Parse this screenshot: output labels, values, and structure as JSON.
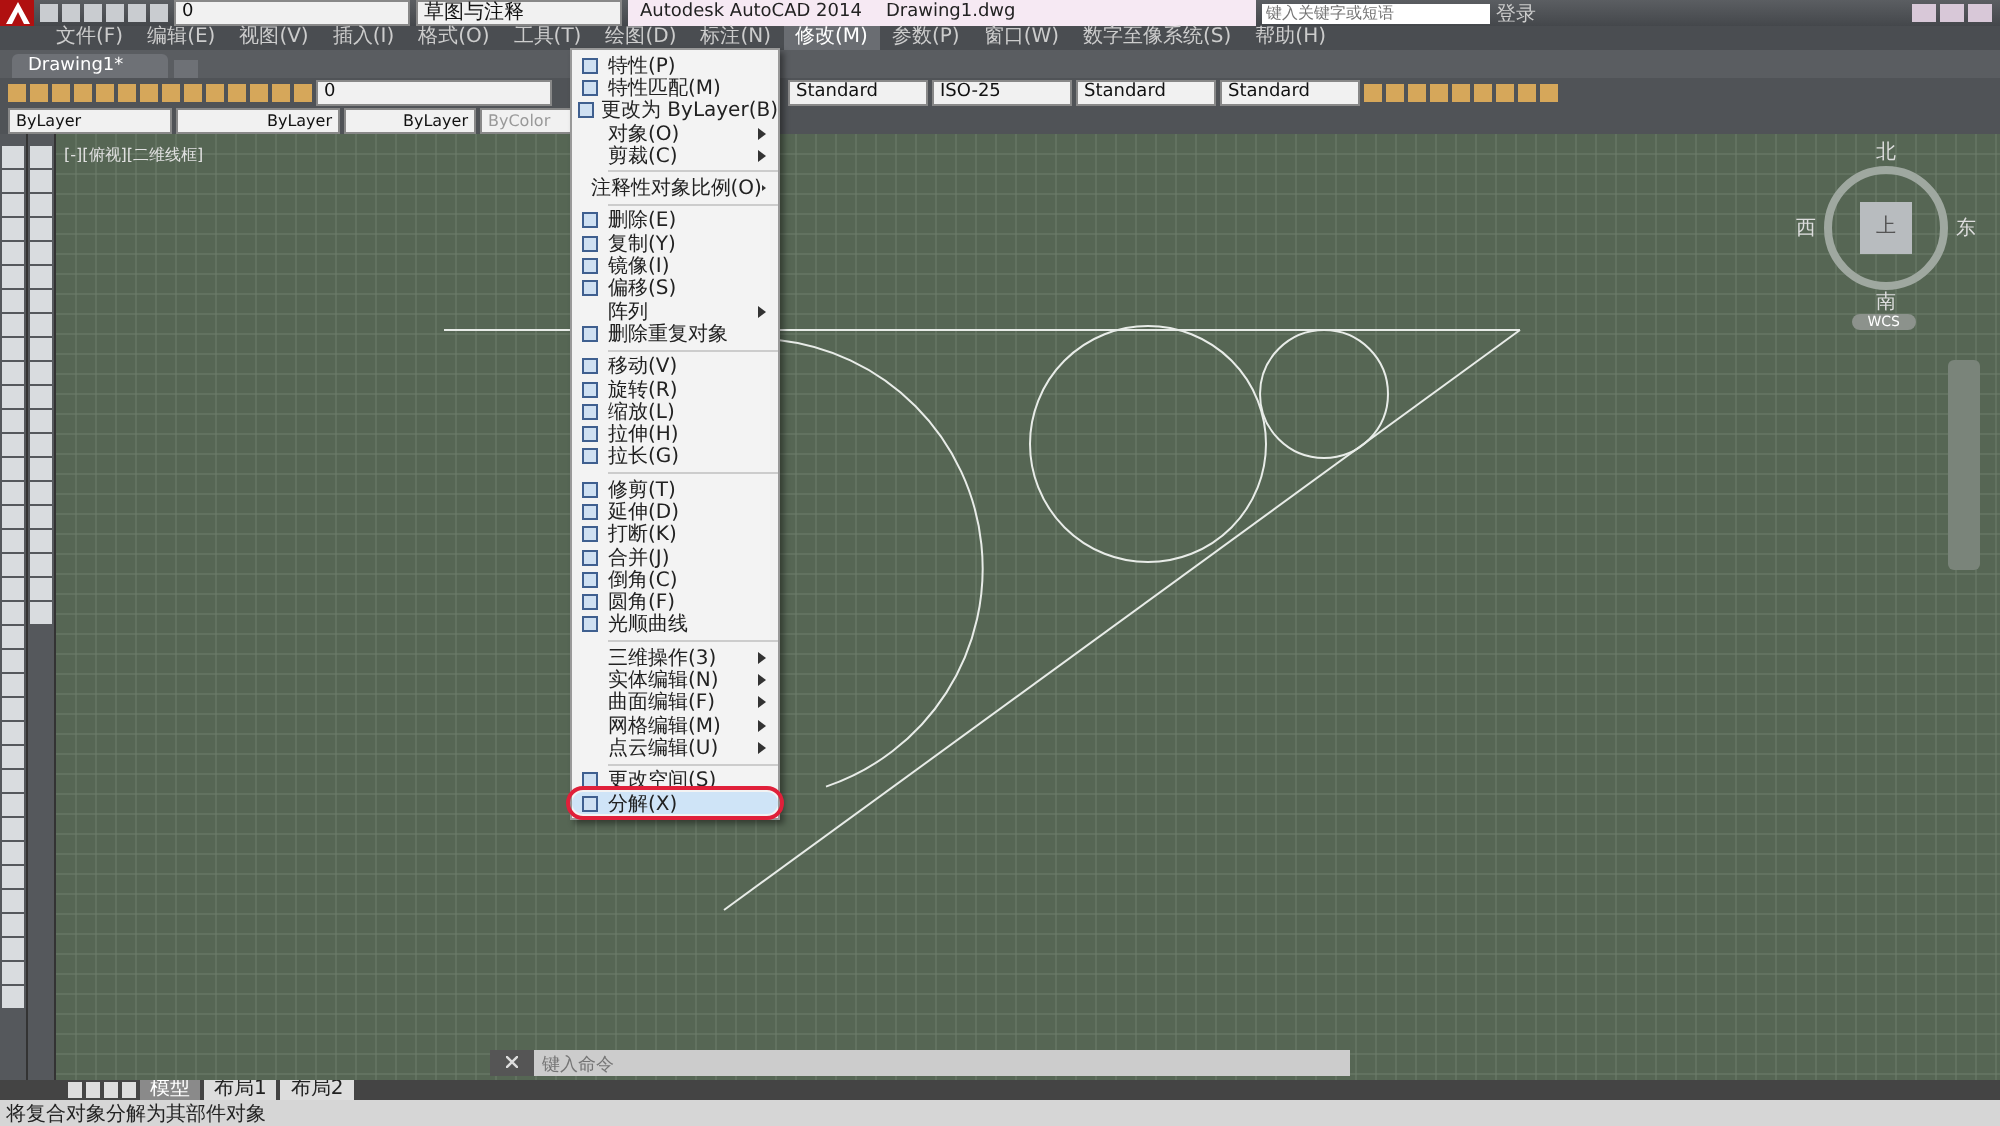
{
  "title_bar": {
    "layer": "0",
    "workspace": "草图与注释",
    "title": "Autodesk AutoCAD 2014",
    "filename": "Drawing1.dwg",
    "search": {
      "placeholder": "键入关键字或短语"
    },
    "sign_in": "登录"
  },
  "menu_bar": [
    {
      "label": "文件(F)",
      "selected": false
    },
    {
      "label": "编辑(E)",
      "selected": false
    },
    {
      "label": "视图(V)",
      "selected": false
    },
    {
      "label": "插入(I)",
      "selected": false
    },
    {
      "label": "格式(O)",
      "selected": false
    },
    {
      "label": "工具(T)",
      "selected": false
    },
    {
      "label": "绘图(D)",
      "selected": false
    },
    {
      "label": "标注(N)",
      "selected": false
    },
    {
      "label": "修改(M)",
      "selected": true
    },
    {
      "label": "参数(P)",
      "selected": false
    },
    {
      "label": "窗口(W)",
      "selected": false
    },
    {
      "label": "数字至像系统(S)",
      "selected": false
    },
    {
      "label": "帮助(H)",
      "selected": false
    }
  ],
  "document_tabs": [
    {
      "label": "Drawing1*",
      "selected": true
    }
  ],
  "toolbar": {
    "layer": "0",
    "text_style": "Standard",
    "dim_style": "ISO-25",
    "table_style": "Standard",
    "multileader_style": "Standard"
  },
  "properties": {
    "color_setting": "ByLayer",
    "linetype": "ByLayer",
    "lineweight": "ByLayer",
    "plot_style": "ByColor"
  },
  "viewport_label": "[-][俯视][二维线框]",
  "viewcube": {
    "north": "北",
    "west": "西",
    "top": "上",
    "east": "东",
    "south": "南",
    "ucs": "WCS"
  },
  "dropdown": {
    "groups": [
      [
        {
          "label": "特性(P)",
          "kind": "command",
          "selected": false,
          "circled": false
        },
        {
          "label": "特性匹配(M)",
          "kind": "command",
          "selected": false,
          "circled": false
        },
        {
          "label": "更改为 ByLayer(B)",
          "kind": "command",
          "selected": false,
          "circled": false
        },
        {
          "label": "对象(O)",
          "kind": "submenu",
          "selected": false,
          "circled": false
        },
        {
          "label": "剪裁(C)",
          "kind": "submenu",
          "selected": false,
          "circled": false
        }
      ],
      [
        {
          "label": "注释性对象比例(O)",
          "kind": "submenu",
          "selected": false,
          "circled": false
        }
      ],
      [
        {
          "label": "删除(E)",
          "kind": "command",
          "selected": false,
          "circled": false
        },
        {
          "label": "复制(Y)",
          "kind": "command",
          "selected": false,
          "circled": false
        },
        {
          "label": "镜像(I)",
          "kind": "command",
          "selected": false,
          "circled": false
        },
        {
          "label": "偏移(S)",
          "kind": "command",
          "selected": false,
          "circled": false
        },
        {
          "label": "阵列",
          "kind": "submenu",
          "selected": false,
          "circled": false
        },
        {
          "label": "删除重复对象",
          "kind": "command",
          "selected": false,
          "circled": false
        }
      ],
      [
        {
          "label": "移动(V)",
          "kind": "command",
          "selected": false,
          "circled": false
        },
        {
          "label": "旋转(R)",
          "kind": "command",
          "selected": false,
          "circled": false
        },
        {
          "label": "缩放(L)",
          "kind": "command",
          "selected": false,
          "circled": false
        },
        {
          "label": "拉伸(H)",
          "kind": "command",
          "selected": false,
          "circled": false
        },
        {
          "label": "拉长(G)",
          "kind": "command",
          "selected": false,
          "circled": false
        }
      ],
      [
        {
          "label": "修剪(T)",
          "kind": "command",
          "selected": false,
          "circled": false
        },
        {
          "label": "延伸(D)",
          "kind": "command",
          "selected": false,
          "circled": false
        },
        {
          "label": "打断(K)",
          "kind": "command",
          "selected": false,
          "circled": false
        },
        {
          "label": "合并(J)",
          "kind": "command",
          "selected": false,
          "circled": false
        },
        {
          "label": "倒角(C)",
          "kind": "command",
          "selected": false,
          "circled": false
        },
        {
          "label": "圆角(F)",
          "kind": "command",
          "selected": false,
          "circled": false
        },
        {
          "label": "光顺曲线",
          "kind": "command",
          "selected": false,
          "circled": false
        }
      ],
      [
        {
          "label": "三维操作(3)",
          "kind": "submenu",
          "selected": false,
          "circled": false
        },
        {
          "label": "实体编辑(N)",
          "kind": "submenu",
          "selected": false,
          "circled": false
        },
        {
          "label": "曲面编辑(F)",
          "kind": "submenu",
          "selected": false,
          "circled": false
        },
        {
          "label": "网格编辑(M)",
          "kind": "submenu",
          "selected": false,
          "circled": false
        },
        {
          "label": "点云编辑(U)",
          "kind": "submenu",
          "selected": false,
          "circled": false
        }
      ],
      [
        {
          "label": "更改空间(S)",
          "kind": "command",
          "selected": false,
          "circled": false
        },
        {
          "label": "分解(X)",
          "kind": "command",
          "selected": true,
          "circled": true
        }
      ]
    ]
  },
  "layout_tabs": [
    {
      "label": "模型",
      "selected": true
    },
    {
      "label": "布局1",
      "selected": false
    },
    {
      "label": "布局2",
      "selected": false
    }
  ],
  "command_line": {
    "placeholder": "键入命令"
  },
  "status_bar": {
    "prompt": "将复合对象分解为其部件对象"
  }
}
